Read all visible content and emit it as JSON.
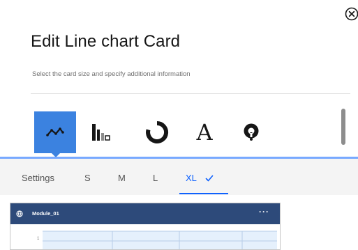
{
  "dialog": {
    "title": "Edit Line chart Card",
    "subtitle": "Select the card size and specify additional information",
    "close_icon": "close-circle-icon"
  },
  "card_types": [
    {
      "icon": "line-chart-icon",
      "selected": true
    },
    {
      "icon": "bar-chart-icon",
      "selected": false
    },
    {
      "icon": "donut-chart-icon",
      "selected": false
    },
    {
      "icon": "text-icon",
      "glyph": "A",
      "selected": false
    },
    {
      "icon": "gauge-icon",
      "selected": false
    }
  ],
  "size_tabs": {
    "settings": "Settings",
    "sizes": [
      "S",
      "M",
      "L",
      "XL"
    ],
    "selected": "XL",
    "check_icon": "checkmark-icon"
  },
  "preview": {
    "module_name": "Module_01",
    "menu": "···",
    "module_icon": "globe-icon",
    "y_tick": "1"
  },
  "colors": {
    "accent": "#3b82e0",
    "link": "#0f62fe",
    "header": "#2d4a7a"
  }
}
